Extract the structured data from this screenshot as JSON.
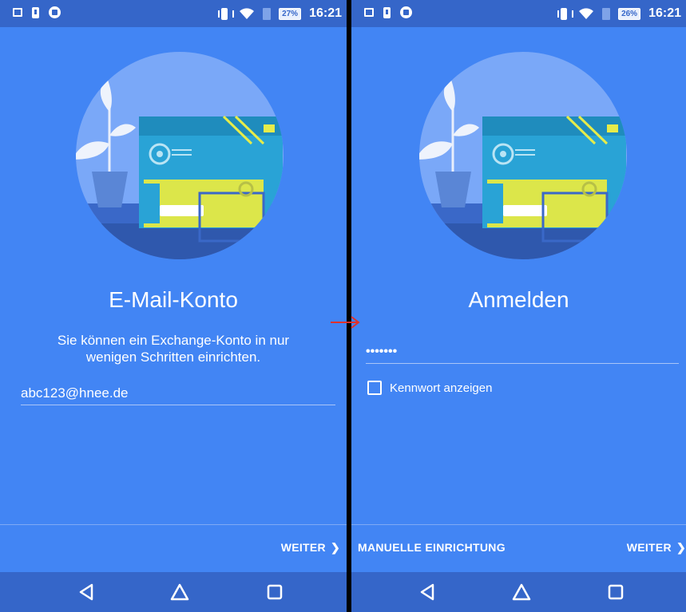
{
  "colors": {
    "background": "#4285f4",
    "status_bar": "#3566c9",
    "nav_bar": "#3566c9",
    "annotation_arrow": "#e0322b"
  },
  "left_screen": {
    "status_bar": {
      "battery": "27%",
      "time": "16:21",
      "icons": [
        "picture-icon",
        "alert-icon",
        "record-icon",
        "vibrate-icon",
        "wifi-icon",
        "sim-icon"
      ]
    },
    "title": "E-Mail-Konto",
    "subtitle_line1": "Sie können ein Exchange-Konto in nur",
    "subtitle_line2": "wenigen Schritten einrichten.",
    "email_value": "abc123@hnee.de",
    "next_label": "WEITER"
  },
  "right_screen": {
    "status_bar": {
      "battery": "26%",
      "time": "16:21",
      "icons": [
        "picture-icon",
        "alert-icon",
        "record-icon",
        "vibrate-icon",
        "wifi-icon",
        "sim-icon"
      ]
    },
    "title": "Anmelden",
    "password_value": "•••••••",
    "show_password_label": "Kennwort anzeigen",
    "manual_setup_label": "MANUELLE EINRICHTUNG",
    "next_label": "WEITER"
  },
  "nav_icons": [
    "back-icon",
    "home-icon",
    "recent-apps-icon"
  ]
}
